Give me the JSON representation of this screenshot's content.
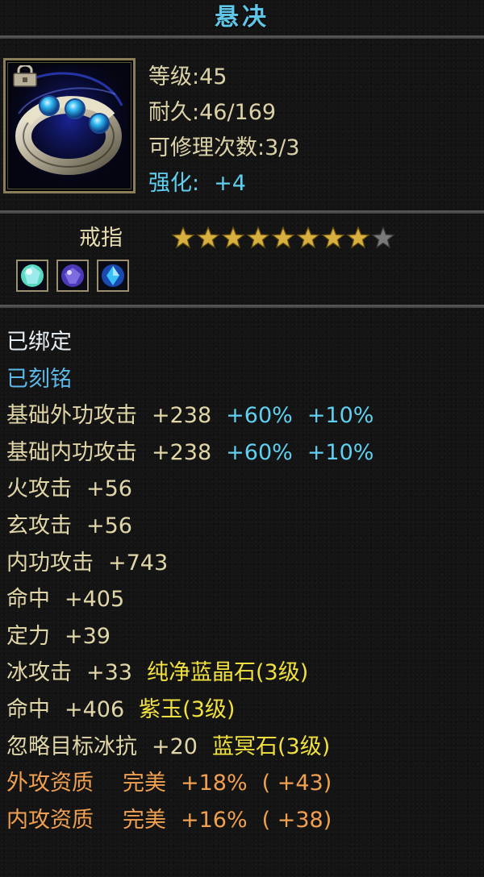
{
  "item": {
    "name": "悬决",
    "icon": "ring-icon",
    "level_line": "等级:45",
    "durability_line": "耐久:46/169",
    "repair_line": "可修理次数:3/3",
    "enhance_label": "强化:",
    "enhance_value": "+4",
    "type": "戒指",
    "stars_filled": 8,
    "stars_total": 9
  },
  "gems": [
    "green-gem-icon",
    "purple-gem-icon",
    "blue-gem-icon"
  ],
  "status": {
    "bound": "已绑定",
    "engraved": "已刻铭"
  },
  "attributes": [
    {
      "name": "基础外功攻击",
      "value": "+238",
      "bonus1": "+60%",
      "bonus2": "+10%"
    },
    {
      "name": "基础内功攻击",
      "value": "+238",
      "bonus1": "+60%",
      "bonus2": "+10%"
    },
    {
      "name": "火攻击",
      "value": "+56"
    },
    {
      "name": "玄攻击",
      "value": "+56"
    },
    {
      "name": "内功攻击",
      "value": "+743"
    },
    {
      "name": "命中",
      "value": "+405"
    },
    {
      "name": "定力",
      "value": "+39"
    }
  ],
  "gem_attributes": [
    {
      "name": "冰攻击",
      "value": "+33",
      "gem": "纯净蓝晶石",
      "level": "(3级)"
    },
    {
      "name": "命中",
      "value": "+406",
      "gem": "紫玉",
      "level": "(3级)"
    },
    {
      "name": "忽略目标冰抗",
      "value": "+20",
      "gem": "蓝冥石",
      "level": "(3级)"
    }
  ],
  "qualities": [
    {
      "name": "外攻资质",
      "grade": "完美",
      "pct": "+18%",
      "bonus": "( +43)"
    },
    {
      "name": "内攻资质",
      "grade": "完美",
      "pct": "+16%",
      "bonus": "( +38)"
    }
  ],
  "colors": {
    "title": "#5fc6e8",
    "enhance": "#5fd0f0",
    "gem_name": "#f0e040",
    "quality": "#f0a050",
    "star": "#d8b040"
  }
}
